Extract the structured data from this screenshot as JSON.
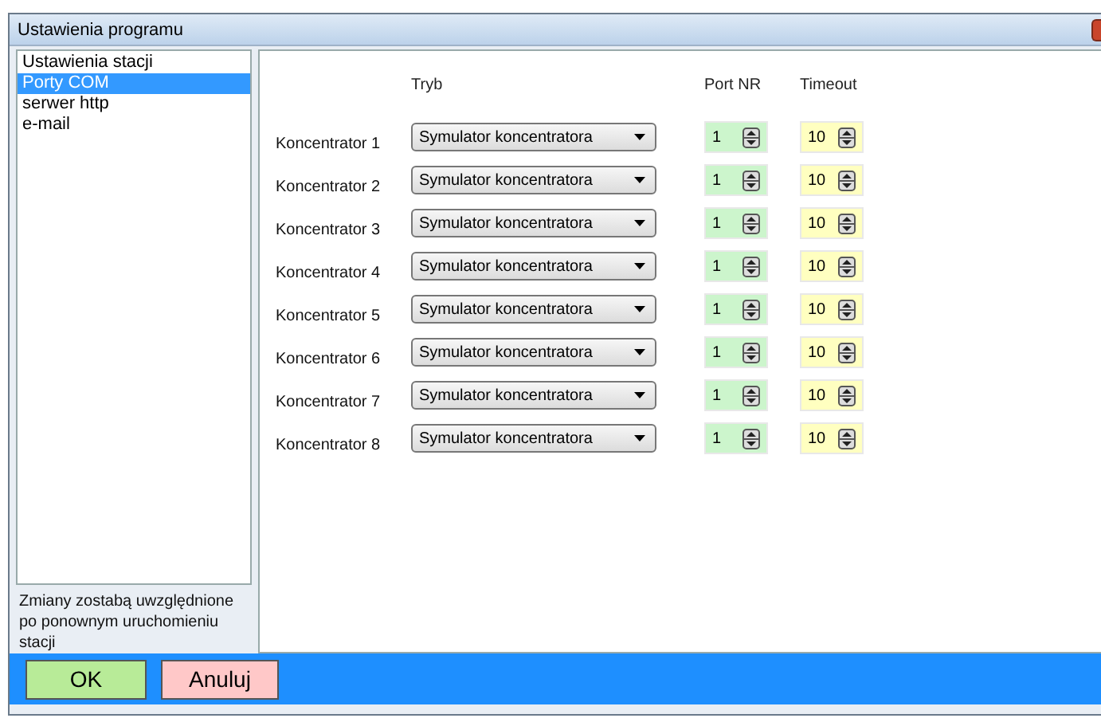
{
  "window": {
    "title": "Ustawienia programu"
  },
  "sidebar": {
    "items": [
      {
        "label": "Ustawienia stacji",
        "selected": false
      },
      {
        "label": "Porty COM",
        "selected": true
      },
      {
        "label": "serwer http",
        "selected": false
      },
      {
        "label": "e-mail",
        "selected": false
      }
    ],
    "note": "Zmiany zostabą uwzględnione po ponownym uruchomieniu stacji"
  },
  "table": {
    "columns": [
      "Tryb",
      "Port NR",
      "Timeout"
    ],
    "rows": [
      {
        "label": "Koncentrator 1",
        "mode": "Symulator koncentratora",
        "port": "1",
        "timeout": "10"
      },
      {
        "label": "Koncentrator 2",
        "mode": "Symulator koncentratora",
        "port": "1",
        "timeout": "10"
      },
      {
        "label": "Koncentrator 3",
        "mode": "Symulator koncentratora",
        "port": "1",
        "timeout": "10"
      },
      {
        "label": "Koncentrator 4",
        "mode": "Symulator koncentratora",
        "port": "1",
        "timeout": "10"
      },
      {
        "label": "Koncentrator 5",
        "mode": "Symulator koncentratora",
        "port": "1",
        "timeout": "10"
      },
      {
        "label": "Koncentrator 6",
        "mode": "Symulator koncentratora",
        "port": "1",
        "timeout": "10"
      },
      {
        "label": "Koncentrator 7",
        "mode": "Symulator koncentratora",
        "port": "1",
        "timeout": "10"
      },
      {
        "label": "Koncentrator 8",
        "mode": "Symulator koncentratora",
        "port": "1",
        "timeout": "10"
      }
    ]
  },
  "buttons": [
    {
      "label": "OK",
      "kind": "ok"
    },
    {
      "label": "Anuluj",
      "kind": "cancel"
    }
  ]
}
